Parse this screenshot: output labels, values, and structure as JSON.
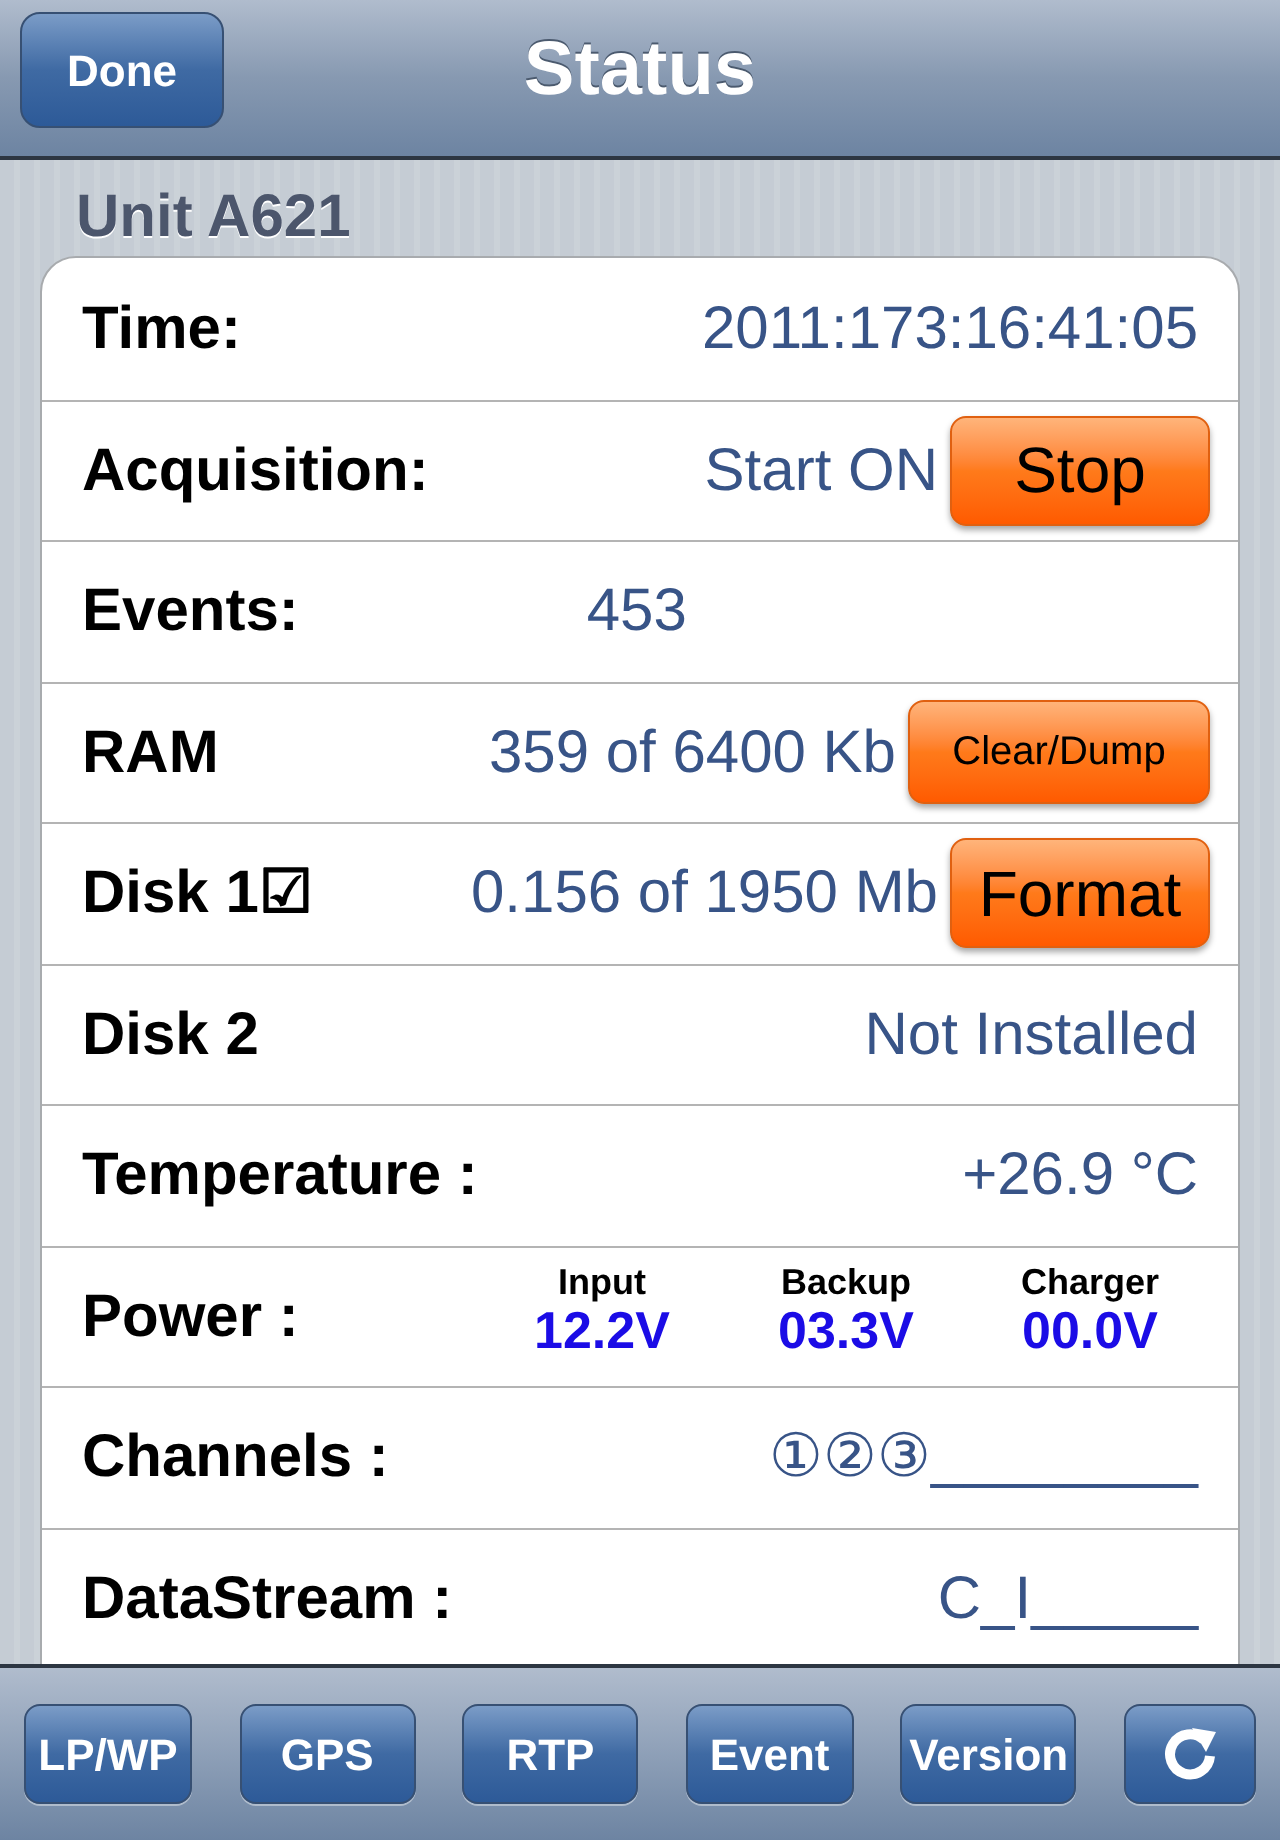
{
  "nav_bar": {
    "title": "Status",
    "done_button": "Done"
  },
  "unit_header": "Unit A621",
  "rows": [
    {
      "kind": "text",
      "label": "Time:",
      "value": "2011:173:16:41:05"
    },
    {
      "kind": "button",
      "label": "Acquisition:",
      "value": "Start ON",
      "button": "Stop"
    },
    {
      "kind": "count",
      "label": "Events:",
      "value": "453"
    },
    {
      "kind": "button",
      "label": "RAM",
      "value": "359 of 6400 Kb",
      "button": "Clear/Dump"
    },
    {
      "kind": "button",
      "label": "Disk 1☑",
      "value": "0.156 of 1950 Mb",
      "button": "Format"
    },
    {
      "kind": "text",
      "label": "Disk 2",
      "value": "Not Installed"
    },
    {
      "kind": "text",
      "label": "Temperature :",
      "value": "+26.9 °C"
    },
    {
      "kind": "power",
      "label": "Power :",
      "readings": [
        {
          "name": "Input",
          "value": "12.2V"
        },
        {
          "name": "Backup",
          "value": "03.3V"
        },
        {
          "name": "Charger",
          "value": "00.0V"
        }
      ]
    },
    {
      "kind": "text",
      "label": "Channels :",
      "value": "①②③________"
    },
    {
      "kind": "text",
      "label": "DataStream :",
      "value": "C_I_____"
    }
  ],
  "toolbar": [
    "LP/WP",
    "GPS",
    "RTP",
    "Event",
    "Version"
  ]
}
